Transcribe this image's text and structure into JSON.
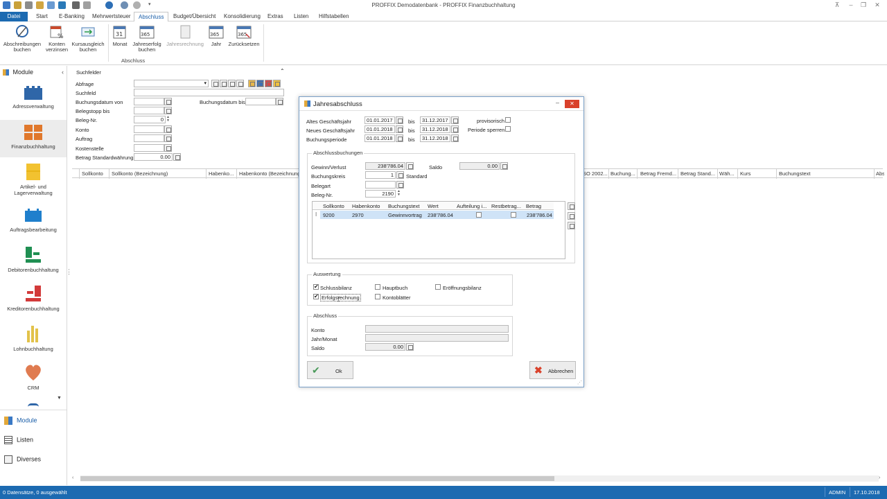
{
  "window": {
    "title": "PROFFIX Demodatenbank - PROFFIX Finanzbuchhaltung"
  },
  "ribbon_tabs": [
    "Datei",
    "Start",
    "E-Banking",
    "Mehrwertsteuer",
    "Abschluss",
    "Budget/Übersicht",
    "Konsolidierung",
    "Extras",
    "Listen",
    "Hilfstabellen"
  ],
  "ribbon": {
    "buttons": [
      {
        "l1": "Abschreibungen",
        "l2": "buchen"
      },
      {
        "l1": "Konten",
        "l2": "verzinsen"
      },
      {
        "l1": "Kursausgleich",
        "l2": "buchen"
      },
      {
        "l1": "Monat",
        "l2": ""
      },
      {
        "l1": "Jahreserfolg",
        "l2": "buchen"
      },
      {
        "l1": "Jahresrechnung",
        "l2": ""
      },
      {
        "l1": "Jahr",
        "l2": ""
      },
      {
        "l1": "Zurücksetzen",
        "l2": ""
      }
    ],
    "group_label": "Abschluss",
    "icon_365": "365"
  },
  "sidebar": {
    "header": "Module",
    "modules": [
      {
        "label1": "Adressverwaltung",
        "label2": "",
        "icon": "building-icon"
      },
      {
        "label1": "Finanzbuchhaltung",
        "label2": "",
        "icon": "ledger-icon"
      },
      {
        "label1": "Artikel- und",
        "label2": "Lagerverwaltung",
        "icon": "box-icon"
      },
      {
        "label1": "Auftragsbearbeitung",
        "label2": "",
        "icon": "order-icon"
      },
      {
        "label1": "Debitorenbuchhaltung",
        "label2": "",
        "icon": "debitor-icon"
      },
      {
        "label1": "Kreditorenbuchhaltung",
        "label2": "",
        "icon": "kreditor-icon"
      },
      {
        "label1": "Lohnbuchhaltung",
        "label2": "",
        "icon": "payroll-icon"
      },
      {
        "label1": "CRM",
        "label2": "",
        "icon": "heart-icon"
      }
    ],
    "bottom": [
      {
        "label": "Module",
        "icon": "modules-grid-icon"
      },
      {
        "label": "Listen",
        "icon": "list-icon"
      },
      {
        "label": "Diverses",
        "icon": "misc-icon"
      }
    ]
  },
  "search_panel": {
    "title": "Suchfelder",
    "fields": {
      "abfrage": "Abfrage",
      "suchfeld": "Suchfeld",
      "buchungsdatum_von": "Buchungsdatum von",
      "buchungsdatum_bis": "Buchungsdatum bis",
      "belegstopp_bis": "Belegstopp bis",
      "beleg_nr": "Beleg-Nr.",
      "beleg_nr_value": "0",
      "konto": "Konto",
      "auftrag": "Auftrag",
      "kostenstelle": "Kostenstelle",
      "betrag": "Betrag Standardwährung",
      "betrag_value": "0.00"
    }
  },
  "grid": {
    "columns": [
      "Sollkonto",
      "Sollkonto (Bezeichnung)",
      "Habenko...",
      "Habenkonto (Bezeichnung)",
      "SO 2002...",
      "Buchung...",
      "Betrag Fremd...",
      "Betrag Stand...",
      "Wäh...",
      "Kurs",
      "Buchungstext",
      "Abs"
    ]
  },
  "status": {
    "left": "0 Datensätze, 0 ausgewählt",
    "user": "ADMIN",
    "date": "17.10.2018"
  },
  "dialog": {
    "title": "Jahresabschluss",
    "altes_gj": {
      "label": "Altes Geschäftsjahr",
      "from": "01.01.2017",
      "to": "31.12.2017"
    },
    "neues_gj": {
      "label": "Neues Geschäftsjahr",
      "from": "01.01.2018",
      "to": "31.12.2018"
    },
    "buchungsperiode": {
      "label": "Buchungsperiode",
      "from": "01.01.2018",
      "to": "31.12.2018"
    },
    "bis": "bis",
    "provisorisch": "provisorisch",
    "periode_sperren": "Periode sperren",
    "abschlussbuchungen": {
      "title": "Abschlussbuchungen",
      "gewinn_label": "Gewinn/Verlust",
      "gewinn_value": "238'786.04",
      "saldo_label": "Saldo",
      "saldo_value": "0.00",
      "buchungskreis_label": "Buchungskreis",
      "buchungskreis_value": "1",
      "buchungskreis_text": "Standard",
      "belegart_label": "Belegart",
      "belegnr_label": "Beleg-Nr.",
      "belegnr_value": "2190",
      "table_headers": [
        "Sollkonto",
        "Habenkonto",
        "Buchungstext",
        "Wert",
        "Aufteilung i...",
        "Restbetrag...",
        "Betrag"
      ],
      "rows": [
        {
          "soll": "9200",
          "haben": "2970",
          "text": "Gewinnvortrag",
          "wert": "238'786.04",
          "aufteilung": false,
          "rest": false,
          "betrag": "238'786.04"
        }
      ]
    },
    "auswertung": {
      "title": "Auswertung",
      "schlussbilanz": "Schlussbilanz",
      "erfolgsrechnung": "Erfolgsrechnung",
      "hauptbuch": "Hauptbuch",
      "kontoblaetter": "Kontoblätter",
      "eroeffnungsbilanz": "Eröffnungsbilanz"
    },
    "abschluss": {
      "title": "Abschluss",
      "konto": "Konto",
      "jahr_monat": "Jahr/Monat",
      "saldo": "Saldo",
      "saldo_value": "0.00"
    },
    "ok": "Ok",
    "abbrechen": "Abbrechen"
  },
  "colors": {
    "accent": "#1c6ab1",
    "ok_check": "#4a9a5a",
    "cancel_x": "#d9412b",
    "selected_row": "#cfe3f7"
  }
}
